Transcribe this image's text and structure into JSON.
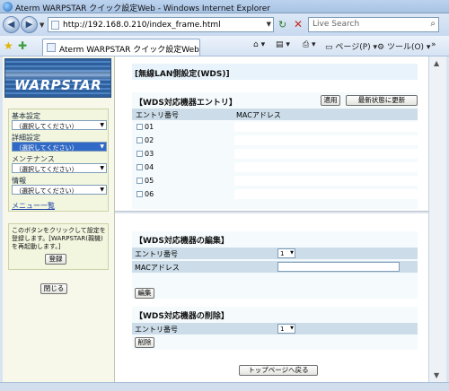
{
  "window": {
    "title": "Aterm WARPSTAR クイック設定Web - Windows Internet Explorer"
  },
  "browser": {
    "url": "http://192.168.0.210/index_frame.html",
    "search_placeholder": "Live Search",
    "tab_label": "Aterm WARPSTAR クイック設定Web",
    "page_menu": "ページ(P)",
    "tools_menu": "ツール(O)"
  },
  "sidebar": {
    "logo_text": "WARPSTAR",
    "menus": [
      {
        "label": "基本設定",
        "selected": "（選択してください）"
      },
      {
        "label": "詳細設定",
        "selected": "（選択してください）"
      },
      {
        "label": "メンテナンス",
        "selected": "（選択してください）"
      },
      {
        "label": "情報",
        "selected": "（選択してください）"
      }
    ],
    "menu_list_link": "メニュー一覧",
    "note_text": "このボタンをクリックして設定を登録します。[WARPSTAR(親機)を再起動します。]",
    "register_button": "登録",
    "close_button": "閉じる"
  },
  "main": {
    "page_title": "[無線LAN側設定(WDS)]",
    "entry_section": {
      "title": "【WDS対応機器エントリ】",
      "apply_button": "適用",
      "refresh_button": "最新状態に更新",
      "col_entry": "エントリ番号",
      "col_mac": "MACアドレス",
      "rows": [
        "01",
        "02",
        "03",
        "04",
        "05",
        "06"
      ]
    },
    "edit_section": {
      "title": "【WDS対応機器の編集】",
      "entry_label": "エントリ番号",
      "entry_value": "1",
      "mac_label": "MACアドレス",
      "mac_value": "",
      "edit_button": "編集"
    },
    "delete_section": {
      "title": "【WDS対応機器の削除】",
      "entry_label": "エントリ番号",
      "entry_value": "1",
      "delete_button": "削除"
    },
    "top_button": "トップページへ戻る"
  }
}
